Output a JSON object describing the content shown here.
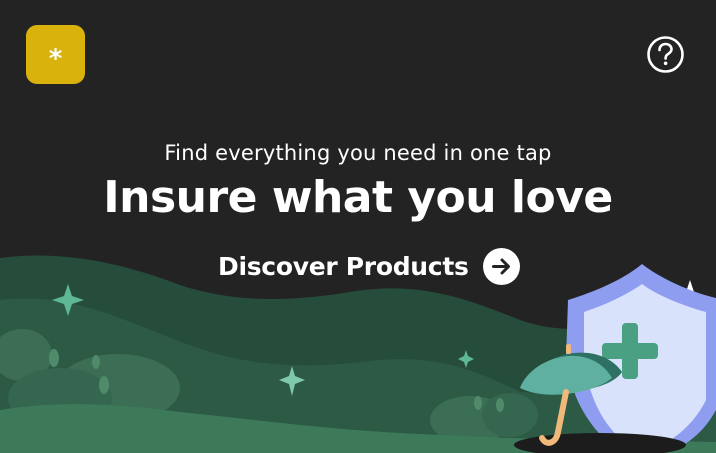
{
  "brand": {
    "logo_glyph": "*",
    "logo_color": "#d9b30c"
  },
  "header": {
    "help_icon": "question-circle-icon"
  },
  "hero": {
    "subtitle": "Find everything you need in one tap",
    "headline": "Insure what you love"
  },
  "cta": {
    "label": "Discover Products",
    "icon": "arrow-right-circle-icon"
  },
  "illustration": {
    "elements": [
      "hills",
      "bushes",
      "sparkles",
      "umbrella",
      "shield-plus"
    ],
    "colors": {
      "background": "#232323",
      "hill_dark": "#2c5a45",
      "hill_light": "#3d7a5a",
      "sparkle": "#5fb894",
      "shield": "#8f9df0",
      "shield_inner": "#d9e2fb",
      "plus": "#4aa082",
      "umbrella": "#4a9e8a",
      "umbrella_handle": "#f0b879"
    }
  }
}
